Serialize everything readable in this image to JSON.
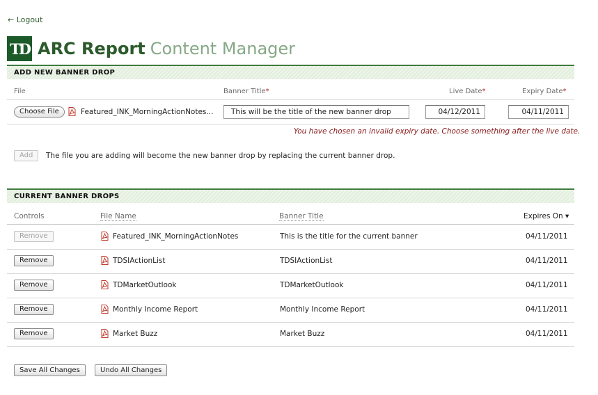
{
  "nav": {
    "logout_label": "← Logout"
  },
  "brand": {
    "logo_text": "TD",
    "title": "ARC Report",
    "subtitle": "Content Manager"
  },
  "add_section": {
    "heading": "ADD NEW BANNER DROP",
    "labels": {
      "file": "File",
      "banner_title": "Banner Title",
      "live_date": "Live Date",
      "expiry_date": "Expiry Date",
      "required_mark": "*"
    },
    "choose_file_label": "Choose File",
    "chosen_file_name": "Featured_INK_MorningActionNotes...",
    "banner_title_value": "This will be the title of the new banner drop",
    "live_date_value": "04/12/2011",
    "expiry_date_value": "04/11/2011",
    "error_message": "You have chosen an invalid expiry date. Choose something after the live date.",
    "add_button_label": "Add",
    "add_note": "The file you are adding will become the new banner drop by replacing the current banner drop."
  },
  "current_section": {
    "heading": "CURRENT BANNER DROPS",
    "columns": {
      "controls": "Controls",
      "file_name": "File Name",
      "banner_title": "Banner Title",
      "expires_on": "Expires On ▾"
    },
    "rows": [
      {
        "remove_label": "Remove",
        "disabled": true,
        "file_name": "Featured_INK_MorningActionNotes",
        "banner_title": "This is the title for the current banner",
        "expires_on": "04/11/2011"
      },
      {
        "remove_label": "Remove",
        "disabled": false,
        "file_name": "TDSIActionList",
        "banner_title": "TDSIActionList",
        "expires_on": "04/11/2011"
      },
      {
        "remove_label": "Remove",
        "disabled": false,
        "file_name": "TDMarketOutlook",
        "banner_title": "TDMarketOutlook",
        "expires_on": "04/11/2011"
      },
      {
        "remove_label": "Remove",
        "disabled": false,
        "file_name": "Monthly Income Report",
        "banner_title": "Monthly Income Report",
        "expires_on": "04/11/2011"
      },
      {
        "remove_label": "Remove",
        "disabled": false,
        "file_name": "Market Buzz",
        "banner_title": "Market Buzz",
        "expires_on": "04/11/2011"
      }
    ]
  },
  "footer": {
    "save_label": "Save All Changes",
    "undo_label": "Undo All Changes"
  },
  "colors": {
    "brand_green": "#1d5a2a",
    "accent_green": "#3d7b3d",
    "error_red": "#8b1a1a",
    "required_red": "#b22222"
  },
  "icons": {
    "file_type": "pdf-icon"
  }
}
